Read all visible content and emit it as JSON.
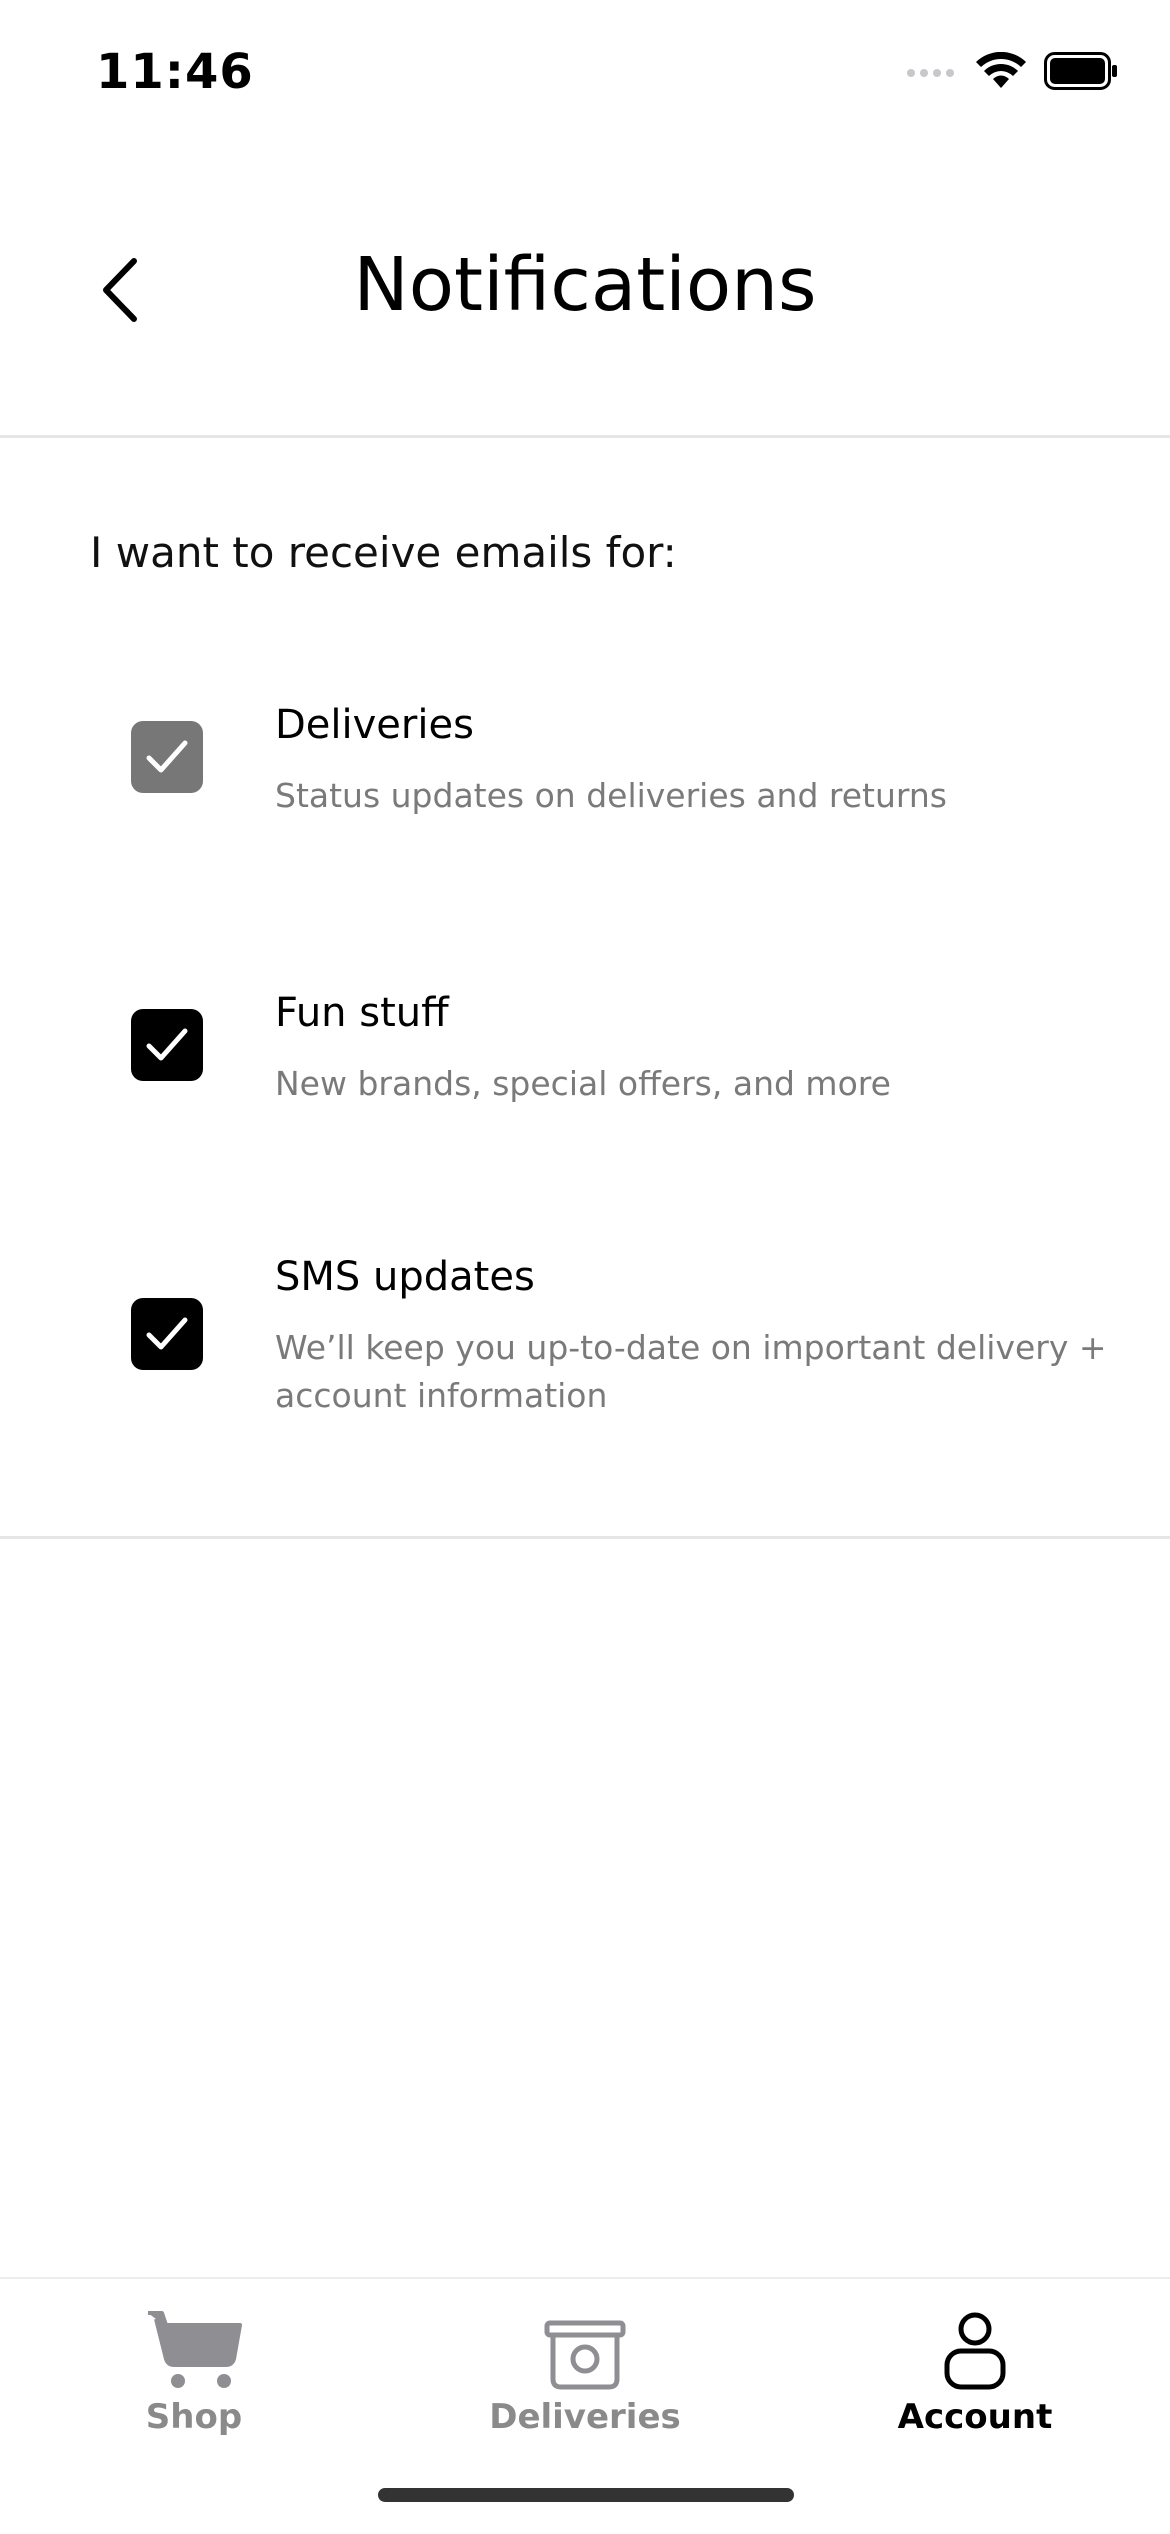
{
  "status_bar": {
    "time": "11:46",
    "icons": [
      "signal-dots-icon",
      "wifi-icon",
      "battery-icon"
    ]
  },
  "header": {
    "title": "Notifications",
    "back_icon": "chevron-left-icon"
  },
  "intro_text": "I want to receive emails for:",
  "options": [
    {
      "title": "Deliveries",
      "description": "Status updates on deliveries and returns",
      "checked": true,
      "disabled": true
    },
    {
      "title": "Fun stuff",
      "description": "New brands, special offers, and more",
      "checked": true,
      "disabled": false
    },
    {
      "title": "SMS updates",
      "description": "We’ll keep you up-to-date on important delivery + account information",
      "checked": true,
      "disabled": false
    }
  ],
  "tab_bar": {
    "tabs": [
      {
        "label": "Shop",
        "icon": "cart-icon",
        "active": false
      },
      {
        "label": "Deliveries",
        "icon": "box-icon",
        "active": false
      },
      {
        "label": "Account",
        "icon": "person-icon",
        "active": true
      }
    ]
  },
  "colors": {
    "checkbox_disabled": "#777777",
    "checkbox_enabled": "#000000",
    "description_text": "#7a7a7a",
    "inactive_tab": "#8a8a8a"
  }
}
